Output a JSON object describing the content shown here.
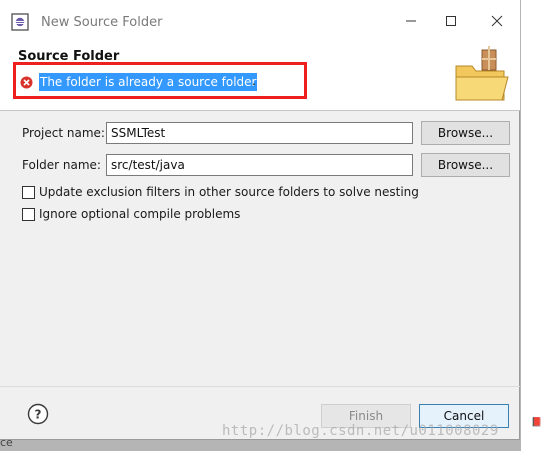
{
  "window": {
    "title": "New Source Folder"
  },
  "header": {
    "page_title": "Source Folder",
    "error_message": "The folder is already a source folder",
    "error_tail": ".",
    "error_icon": "error-icon",
    "banner_icon": "folder-package-icon"
  },
  "form": {
    "project_label": "Project name:",
    "project_value": "SSMLTest",
    "folder_label": "Folder name:",
    "folder_value": "src/test/java",
    "browse_label": "Browse...",
    "checkbox_exclusion": {
      "label": "Update exclusion filters in other source folders to solve nesting",
      "checked": false
    },
    "checkbox_ignore": {
      "label": "Ignore optional compile problems",
      "checked": false
    }
  },
  "footer": {
    "help_icon": "help-icon",
    "finish_label": "Finish",
    "finish_enabled": false,
    "cancel_label": "Cancel"
  },
  "background": {
    "watermark": "http://blog.csdn.net/u011008029",
    "behind_text": "ce"
  },
  "colors": {
    "highlight_border": "#ee1f1f",
    "selection": "#3399ff",
    "error_red": "#d9342b"
  }
}
